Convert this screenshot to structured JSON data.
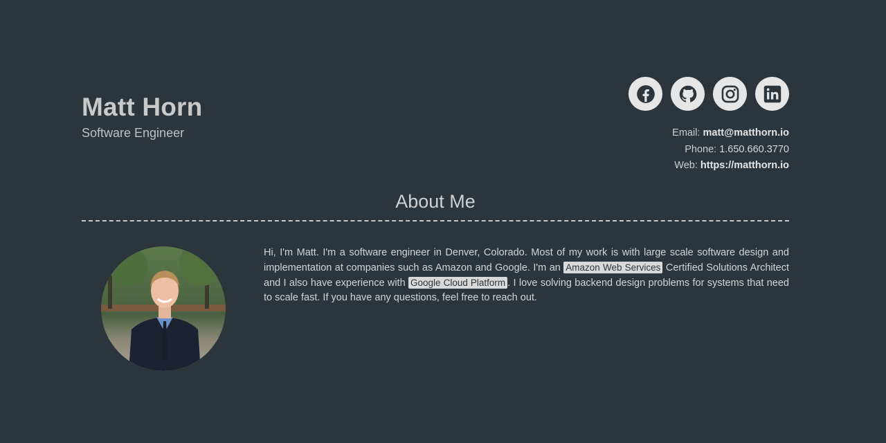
{
  "header": {
    "name": "Matt Horn",
    "title": "Software Engineer"
  },
  "socials": [
    {
      "name": "facebook-icon"
    },
    {
      "name": "github-icon"
    },
    {
      "name": "instagram-icon"
    },
    {
      "name": "linkedin-icon"
    }
  ],
  "contact": {
    "email_label": "Email:",
    "email": "matt@matthorn.io",
    "phone_label": "Phone:",
    "phone": "1.650.660.3770",
    "web_label": "Web:",
    "web": "https://matthorn.io"
  },
  "about": {
    "heading": "About Me",
    "bio_part1": "Hi, I'm Matt. I'm a software engineer in Denver, Colorado. Most of my work is with large scale software design and implementation at companies such as Amazon and Google. I'm an ",
    "tag1": "Amazon Web Services",
    "bio_part2": " Certified Solutions Architect and I also have experience with ",
    "tag2": "Google Cloud Platform",
    "bio_part3": ". I love solving backend design problems for systems that need to scale fast. If you have any questions, feel free to reach out."
  },
  "colors": {
    "background": "#2c353c",
    "icon_circle": "#e6e6e6",
    "icon_glyph": "#2c353c",
    "tag_bg": "#d9d9d9"
  }
}
